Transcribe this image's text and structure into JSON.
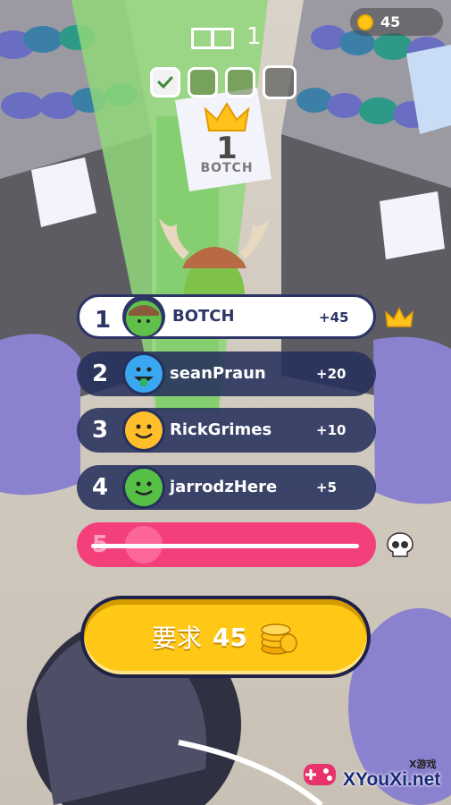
{
  "hud": {
    "coins": "45",
    "round_number": "1",
    "progress": [
      {
        "state": "done"
      },
      {
        "state": "pending"
      },
      {
        "state": "pending"
      },
      {
        "state": "current"
      }
    ]
  },
  "leader_badge": {
    "rank": "1",
    "name": "BOTCH"
  },
  "leaderboard": {
    "rows": [
      {
        "rank": "1",
        "name": "BOTCH",
        "score": "+45",
        "avatar_color": "#5fc04a",
        "status": "crown"
      },
      {
        "rank": "2",
        "name": "seanPraun",
        "score": "+20",
        "avatar_color": "#3aa8f0"
      },
      {
        "rank": "3",
        "name": "RickGrimes",
        "score": "+10",
        "avatar_color": "#ffbe2a"
      },
      {
        "rank": "4",
        "name": "jarrodzHere",
        "score": "+5",
        "avatar_color": "#56c046"
      },
      {
        "rank": "5",
        "avatar_color": "#ff6fa0",
        "status": "eliminated"
      }
    ]
  },
  "claim_button": {
    "label": "要求",
    "amount": "45"
  },
  "watermark": {
    "tag": "X游戏",
    "text": "XYouXi.net"
  },
  "colors": {
    "row_dark": "#26305c",
    "eliminated": "#f4407a",
    "claim_yellow": "#ffc816",
    "coin_gold": "#ffc619"
  }
}
